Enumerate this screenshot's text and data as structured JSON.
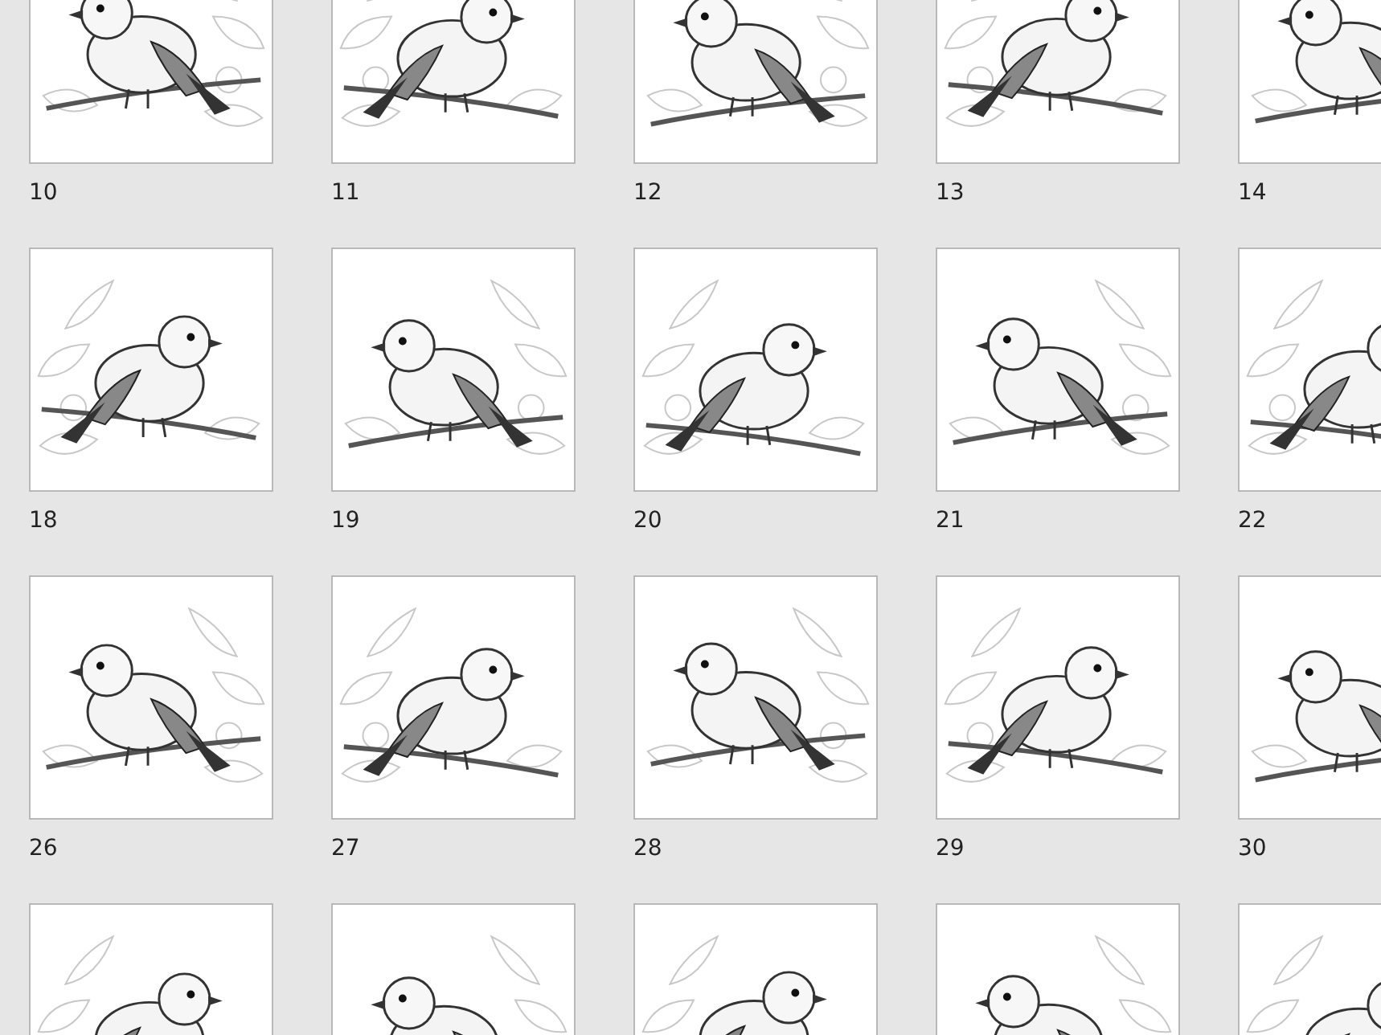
{
  "thumbnails": [
    {
      "kind": "picture",
      "label": "10"
    },
    {
      "kind": "picture",
      "label": "11"
    },
    {
      "kind": "picture",
      "label": "12"
    },
    {
      "kind": "picture",
      "label": "13"
    },
    {
      "kind": "picture",
      "label": "14"
    },
    {
      "kind": "picture",
      "label": "18"
    },
    {
      "kind": "picture",
      "label": "19"
    },
    {
      "kind": "picture",
      "label": "20"
    },
    {
      "kind": "picture",
      "label": "21"
    },
    {
      "kind": "picture",
      "label": "22"
    },
    {
      "kind": "picture",
      "label": "26"
    },
    {
      "kind": "picture",
      "label": "27"
    },
    {
      "kind": "picture",
      "label": "28"
    },
    {
      "kind": "picture",
      "label": "29"
    },
    {
      "kind": "picture",
      "label": "30"
    },
    {
      "kind": "picture"
    },
    {
      "kind": "picture"
    },
    {
      "kind": "picture"
    },
    {
      "kind": "picture"
    },
    {
      "kind": "picture"
    }
  ]
}
